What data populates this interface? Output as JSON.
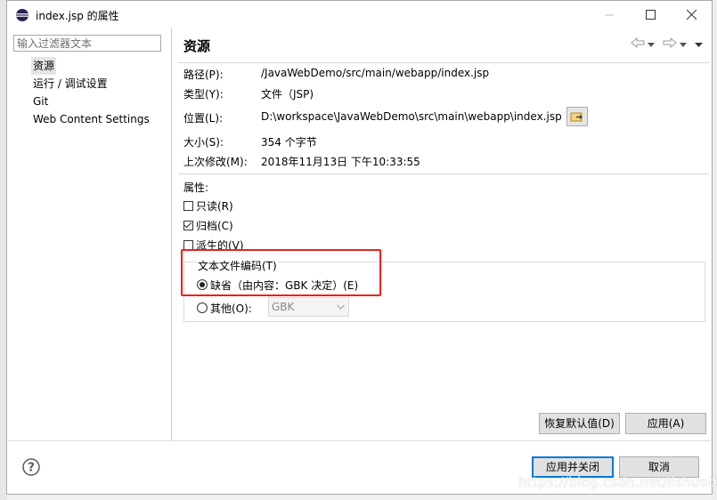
{
  "window": {
    "title": "index.jsp 的属性",
    "minimize_glyph": "—",
    "maximize_glyph": "☐",
    "close_glyph": "✕"
  },
  "filter": {
    "placeholder": "输入过滤器文本"
  },
  "tree": {
    "items": [
      {
        "label": "资源",
        "selected": true
      },
      {
        "label": "运行 / 调试设置"
      },
      {
        "label": "Git"
      },
      {
        "label": "Web Content Settings"
      }
    ]
  },
  "page": {
    "title": "资源",
    "path_label": "路径(P):",
    "path_value": "/JavaWebDemo/src/main/webapp/index.jsp",
    "type_label": "类型(Y):",
    "type_value": "文件（JSP)",
    "location_label": "位置(L):",
    "location_value": "D:\\workspace\\JavaWebDemo\\src\\main\\webapp\\index.jsp",
    "size_label": "大小(S):",
    "size_value": "354 个字节",
    "modified_label": "上次修改(M):",
    "modified_value": "2018年11月13日 下午10:33:55",
    "attributes_label": "属性:",
    "readonly_label": "只读(R)",
    "readonly_checked": false,
    "archive_label": "归档(C)",
    "archive_checked": true,
    "derived_label": "派生的(V)",
    "derived_checked": false,
    "encoding_group_label": "文本文件编码(T)",
    "default_encoding_label": "缺省（由内容：GBK 决定）(E)",
    "default_encoding_selected": true,
    "other_encoding_label": "其他(O):",
    "other_encoding_value": "GBK",
    "restore_defaults_button": "恢复默认值(D)",
    "apply_button": "应用(A)"
  },
  "footer": {
    "help_glyph": "?",
    "apply_close_button": "应用并关闭",
    "cancel_button": "取消"
  },
  "watermark": "https://blog.csdn.net/lishuoboy",
  "colors": {
    "highlight_box": "#e8231f",
    "default_button_border": "#0078d7",
    "selection": "#e5e5e5"
  },
  "icons": {
    "app": "eclipse-icon",
    "nav_back": "back-arrow-icon",
    "nav_forward": "forward-arrow-icon",
    "menu": "view-menu-icon",
    "location": "show-in-explorer-icon",
    "help": "help-icon"
  }
}
